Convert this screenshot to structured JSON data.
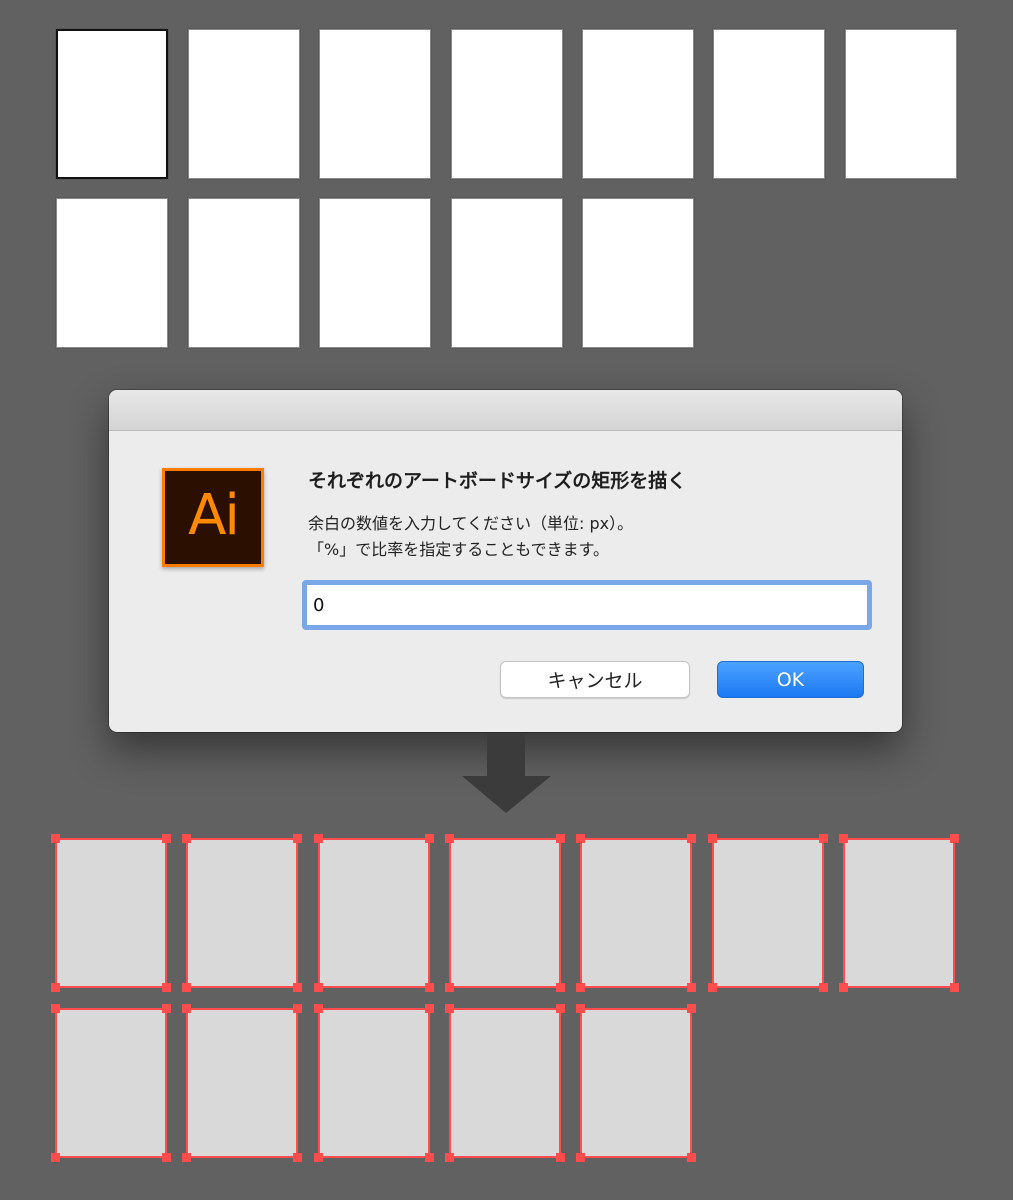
{
  "dialog": {
    "title": "それぞれのアートボードサイズの矩形を描く",
    "message_line1": "余白の数値を入力してください（単位: px）。",
    "message_line2": "「%」で比率を指定することもできます。",
    "input_value": "0",
    "cancel_label": "キャンセル",
    "ok_label": "OK",
    "logo_text": "Ai"
  },
  "colors": {
    "background": "#616161",
    "accent": "#ff4d4d",
    "ok_button": "#1a78f2",
    "logo_orange": "#ff7c00"
  },
  "artboard_count": 12,
  "active_artboard_index": 0,
  "rectangle_count": 12
}
